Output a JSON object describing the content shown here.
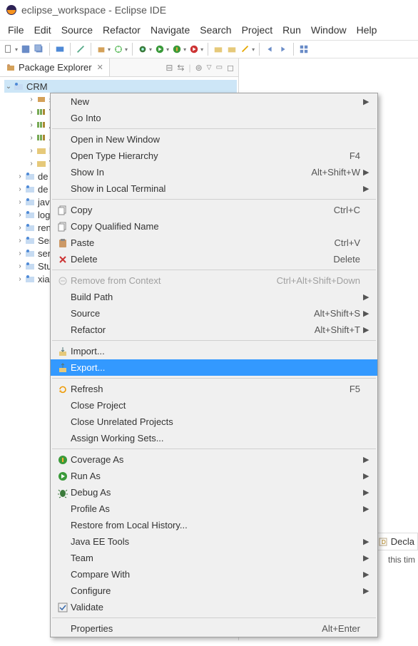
{
  "window_title": "eclipse_workspace - Eclipse IDE",
  "menubar": [
    "File",
    "Edit",
    "Source",
    "Refactor",
    "Navigate",
    "Search",
    "Project",
    "Run",
    "Window",
    "Help"
  ],
  "explorer_tab": "Package Explorer",
  "tree": {
    "root": "CRM",
    "children_l2": [
      "s",
      "V",
      "A",
      "J",
      "b",
      "V"
    ],
    "siblings": [
      "de",
      "de",
      "java",
      "log",
      "ren",
      "Ser",
      "serv",
      "Stu",
      "xiao"
    ]
  },
  "context_menu": {
    "g1": [
      {
        "label": "New",
        "arrow": true
      },
      {
        "label": "Go Into"
      }
    ],
    "g2": [
      {
        "label": "Open in New Window"
      },
      {
        "label": "Open Type Hierarchy",
        "shortcut": "F4"
      },
      {
        "label": "Show In",
        "shortcut": "Alt+Shift+W",
        "arrow": true
      },
      {
        "label": "Show in Local Terminal",
        "arrow": true
      }
    ],
    "g3": [
      {
        "label": "Copy",
        "shortcut": "Ctrl+C",
        "icon": "copy"
      },
      {
        "label": "Copy Qualified Name",
        "icon": "copy"
      },
      {
        "label": "Paste",
        "shortcut": "Ctrl+V",
        "icon": "paste"
      },
      {
        "label": "Delete",
        "shortcut": "Delete",
        "icon": "delete"
      }
    ],
    "g4": [
      {
        "label": "Remove from Context",
        "shortcut": "Ctrl+Alt+Shift+Down",
        "disabled": true,
        "icon": "remove"
      },
      {
        "label": "Build Path",
        "arrow": true
      },
      {
        "label": "Source",
        "shortcut": "Alt+Shift+S",
        "arrow": true
      },
      {
        "label": "Refactor",
        "shortcut": "Alt+Shift+T",
        "arrow": true
      }
    ],
    "g5": [
      {
        "label": "Import...",
        "icon": "import"
      },
      {
        "label": "Export...",
        "icon": "export",
        "highlighted": true
      }
    ],
    "g6": [
      {
        "label": "Refresh",
        "shortcut": "F5",
        "icon": "refresh"
      },
      {
        "label": "Close Project"
      },
      {
        "label": "Close Unrelated Projects"
      },
      {
        "label": "Assign Working Sets..."
      }
    ],
    "g7": [
      {
        "label": "Coverage As",
        "arrow": true,
        "icon": "coverage"
      },
      {
        "label": "Run As",
        "arrow": true,
        "icon": "run"
      },
      {
        "label": "Debug As",
        "arrow": true,
        "icon": "debug"
      },
      {
        "label": "Profile As",
        "arrow": true
      },
      {
        "label": "Restore from Local History..."
      },
      {
        "label": "Java EE Tools",
        "arrow": true
      },
      {
        "label": "Team",
        "arrow": true
      },
      {
        "label": "Compare With",
        "arrow": true
      },
      {
        "label": "Configure",
        "arrow": true
      },
      {
        "label": "Validate",
        "icon": "check"
      }
    ],
    "g8": [
      {
        "label": "Properties",
        "shortcut": "Alt+Enter"
      }
    ]
  },
  "decl_tab": "Decla",
  "decl_text": "this tim"
}
